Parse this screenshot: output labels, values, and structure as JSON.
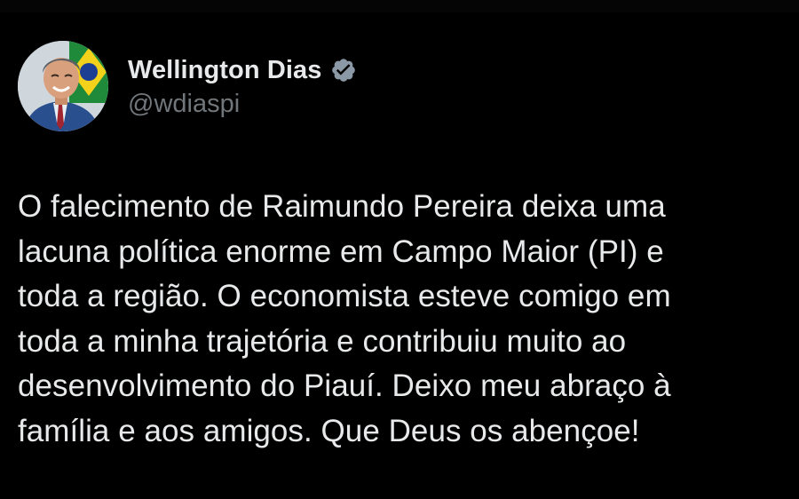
{
  "author": {
    "display_name": "Wellington Dias",
    "handle": "@wdiaspi",
    "verified": true,
    "avatar_icon": "profile-photo-icon"
  },
  "tweet": {
    "text": "O falecimento de Raimundo Pereira deixa uma\nlacuna política enorme em Campo Maior (PI) e\ntoda a região. O economista esteve comigo em\ntoda a minha trajetória e contribuiu muito ao\ndesenvolvimento do Piauí. Deixo meu abraço à\nfamília e aos amigos. Que Deus os abençoe!"
  },
  "colors": {
    "background": "#000000",
    "text_primary": "#e7e9ea",
    "text_secondary": "#71767b",
    "verified_badge": "#8b98a5"
  }
}
